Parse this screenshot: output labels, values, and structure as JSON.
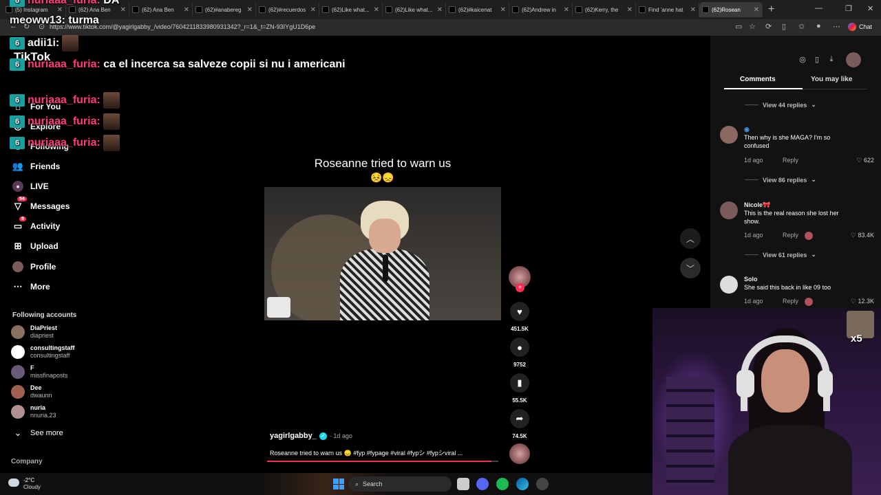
{
  "browser": {
    "tabs": [
      {
        "label": "(5) Instagram"
      },
      {
        "label": "(62) Ana Ben"
      },
      {
        "label": "(62) Ana Ben"
      },
      {
        "label": "(62)#anabereg"
      },
      {
        "label": "(62)#recuerdos"
      },
      {
        "label": "(62)Like what..."
      },
      {
        "label": "(62)Like what..."
      },
      {
        "label": "(62)#kaicenat"
      },
      {
        "label": "(62)Andrew in"
      },
      {
        "label": "(62)Kerry, the"
      },
      {
        "label": "Find 'anne hat"
      },
      {
        "label": "(62)Rosean"
      }
    ],
    "url": "https://www.tiktok.com/@yagirlgabby_/video/7604211833980931342?_r=1&_t=ZN-93IYgU1D6pe",
    "chat_label": "Chat"
  },
  "stream_chat": [
    {
      "user": "nuriaaa_furia:",
      "message": "DA",
      "user_color": "pink"
    },
    {
      "user": "meoww13:",
      "message": "turma",
      "user_color": "white"
    },
    {
      "user": "adii1i:",
      "message": "",
      "user_color": "white"
    },
    {
      "user": "nuriaaa_furia:",
      "message": "ca el incerca sa salveze copii si nu i americani",
      "user_color": "pink"
    },
    {
      "user": "nuriaaa_furia:",
      "message": "",
      "user_color": "pink"
    },
    {
      "user": "nuriaaa_furia:",
      "message": "",
      "user_color": "pink"
    },
    {
      "user": "nuriaaa_furia:",
      "message": "",
      "user_color": "pink"
    }
  ],
  "tiktok": {
    "logo_text": "TikTok",
    "nav": [
      {
        "label": "For You",
        "icon": "home-icon"
      },
      {
        "label": "Explore",
        "icon": "compass-icon"
      },
      {
        "label": "Following",
        "icon": "following-icon"
      },
      {
        "label": "Friends",
        "icon": "friends-icon"
      },
      {
        "label": "LIVE",
        "icon": "live-icon"
      },
      {
        "label": "Messages",
        "icon": "messages-icon",
        "badge": "54"
      },
      {
        "label": "Activity",
        "icon": "activity-icon",
        "badge": "8"
      },
      {
        "label": "Upload",
        "icon": "upload-icon"
      },
      {
        "label": "Profile",
        "icon": "profile-icon"
      },
      {
        "label": "More",
        "icon": "more-icon"
      }
    ],
    "following_heading": "Following accounts",
    "following_accounts": [
      {
        "name": "DiaPriest",
        "handle": "diapriest"
      },
      {
        "name": "consultingstaff",
        "handle": "consultingstaff"
      },
      {
        "name": "F",
        "handle": "missfinaposts"
      },
      {
        "name": "Dee",
        "handle": "dwaunn"
      },
      {
        "name": "nuria",
        "handle": "nnuria.23"
      }
    ],
    "see_more": "See more",
    "company": "Company"
  },
  "video": {
    "overlay_title": "Roseanne tried to warn us",
    "overlay_emoji": "😣😞",
    "author": "yagirlgabby_",
    "date": "· 1d ago",
    "description": "Roseanne tried to warn us 😞 #fyp #fypage #viral #fypシ #fypシviral ...",
    "likes": "451.5K",
    "comments": "9752",
    "saves": "55.5K",
    "shares": "74.5K",
    "progress": 0.97
  },
  "right_panel": {
    "tab_comments": "Comments",
    "tab_you_may_like": "You may like",
    "view_replies_1": "View 44 replies",
    "view_replies_2": "View 86 replies",
    "view_replies_3": "View 61 replies",
    "comments": [
      {
        "user": "",
        "text": "Then why is she MAGA? I'm so confused",
        "date": "1d ago",
        "reply": "Reply",
        "likes": "622"
      },
      {
        "user": "Nicole🎀",
        "text": "This is the real reason she lost her show.",
        "date": "1d ago",
        "reply": "Reply",
        "likes": "83.4K"
      },
      {
        "user": "Solo",
        "text": "She said this back in like 09 too",
        "date": "1d ago",
        "reply": "Reply",
        "likes": "12.3K"
      }
    ]
  },
  "webcam": {
    "multiplier": "x5"
  },
  "taskbar": {
    "temperature": "-2°C",
    "weather": "Cloudy",
    "search_label": "Search"
  }
}
